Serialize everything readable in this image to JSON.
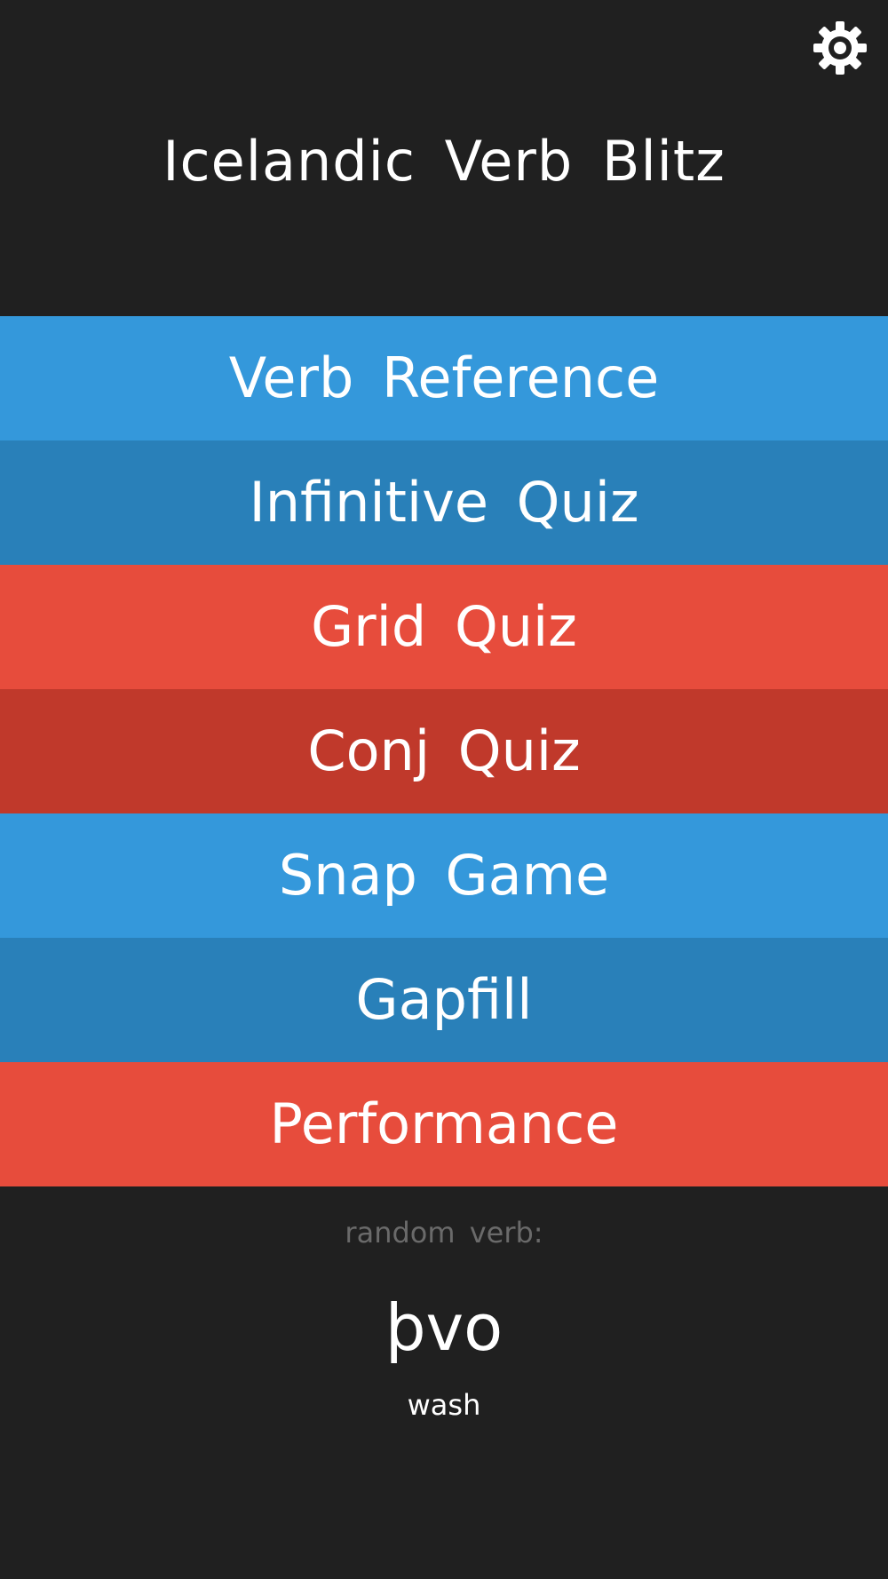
{
  "header": {
    "title": "Icelandic Verb Blitz",
    "settings_icon": "gear-icon"
  },
  "menu": {
    "items": [
      {
        "id": "verb-reference",
        "label": "Verb Reference",
        "color": "#3498db"
      },
      {
        "id": "infinitive-quiz",
        "label": "Infinitive Quiz",
        "color": "#2980b9"
      },
      {
        "id": "grid-quiz",
        "label": "Grid Quiz",
        "color": "#e74c3c"
      },
      {
        "id": "conj-quiz",
        "label": "Conj Quiz",
        "color": "#c0392b"
      },
      {
        "id": "snap-game",
        "label": "Snap Game",
        "color": "#3498db"
      },
      {
        "id": "gapfill",
        "label": "Gapfill",
        "color": "#2980b9"
      },
      {
        "id": "performance",
        "label": "Performance",
        "color": "#e74c3c"
      }
    ]
  },
  "random": {
    "label": "random verb:",
    "verb": "þvo",
    "translation": "wash"
  },
  "colors": {
    "background": "#202020",
    "text": "#ffffff",
    "muted_text": "#6a6a6a"
  }
}
